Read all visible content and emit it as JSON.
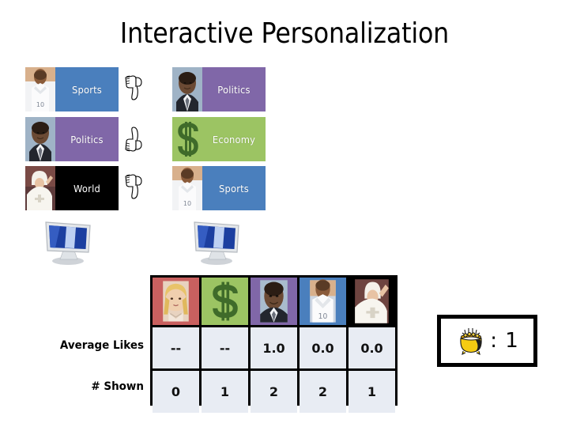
{
  "page": {
    "title": "Interactive Personalization"
  },
  "colors": {
    "sports": "#4a7fbd",
    "politics": "#8067a8",
    "economy": "#9cc463",
    "world": "#000000",
    "celebrity": "#c9605f",
    "cell_bg": "#e8ecf3",
    "table_border": "#000000",
    "gold": "#f2cb16"
  },
  "feed": {
    "left_column": [
      {
        "label": "Sports",
        "color_key": "sports",
        "thumb": "soccer-player-thumb",
        "feedback": "thumbs-down"
      },
      {
        "label": "Politics",
        "color_key": "politics",
        "thumb": "obama-thumb",
        "feedback": "thumbs-up"
      },
      {
        "label": "World",
        "color_key": "world",
        "thumb": "pope-thumb",
        "feedback": "thumbs-down"
      }
    ],
    "right_column": [
      {
        "label": "Politics",
        "color_key": "politics",
        "thumb": "obama-thumb"
      },
      {
        "label": "Economy",
        "color_key": "economy",
        "thumb": "dollar-sign-thumb"
      },
      {
        "label": "Sports",
        "color_key": "sports",
        "thumb": "soccer-player-thumb"
      }
    ]
  },
  "devices": [
    {
      "icon": "computer-monitor-icon"
    },
    {
      "icon": "computer-monitor-icon"
    }
  ],
  "stats_table": {
    "columns": [
      {
        "category": "Celebrity",
        "thumb": "celebrity-thumb",
        "color_key": "celebrity"
      },
      {
        "category": "Economy",
        "thumb": "dollar-sign-thumb",
        "color_key": "economy"
      },
      {
        "category": "Politics",
        "thumb": "obama-thumb",
        "color_key": "politics"
      },
      {
        "category": "Sports",
        "thumb": "soccer-player-thumb",
        "color_key": "sports"
      },
      {
        "category": "World",
        "thumb": "pope-thumb",
        "color_key": "world"
      }
    ],
    "rows": [
      {
        "label": "Average Likes",
        "values": [
          "--",
          "--",
          "1.0",
          "0.0",
          "0.0"
        ]
      },
      {
        "label": "# Shown",
        "values": [
          "0",
          "1",
          "2",
          "2",
          "1"
        ]
      }
    ]
  },
  "score": {
    "icon": "pot-of-gold-icon",
    "separator": ":",
    "value": "1",
    "display": ": 1"
  }
}
